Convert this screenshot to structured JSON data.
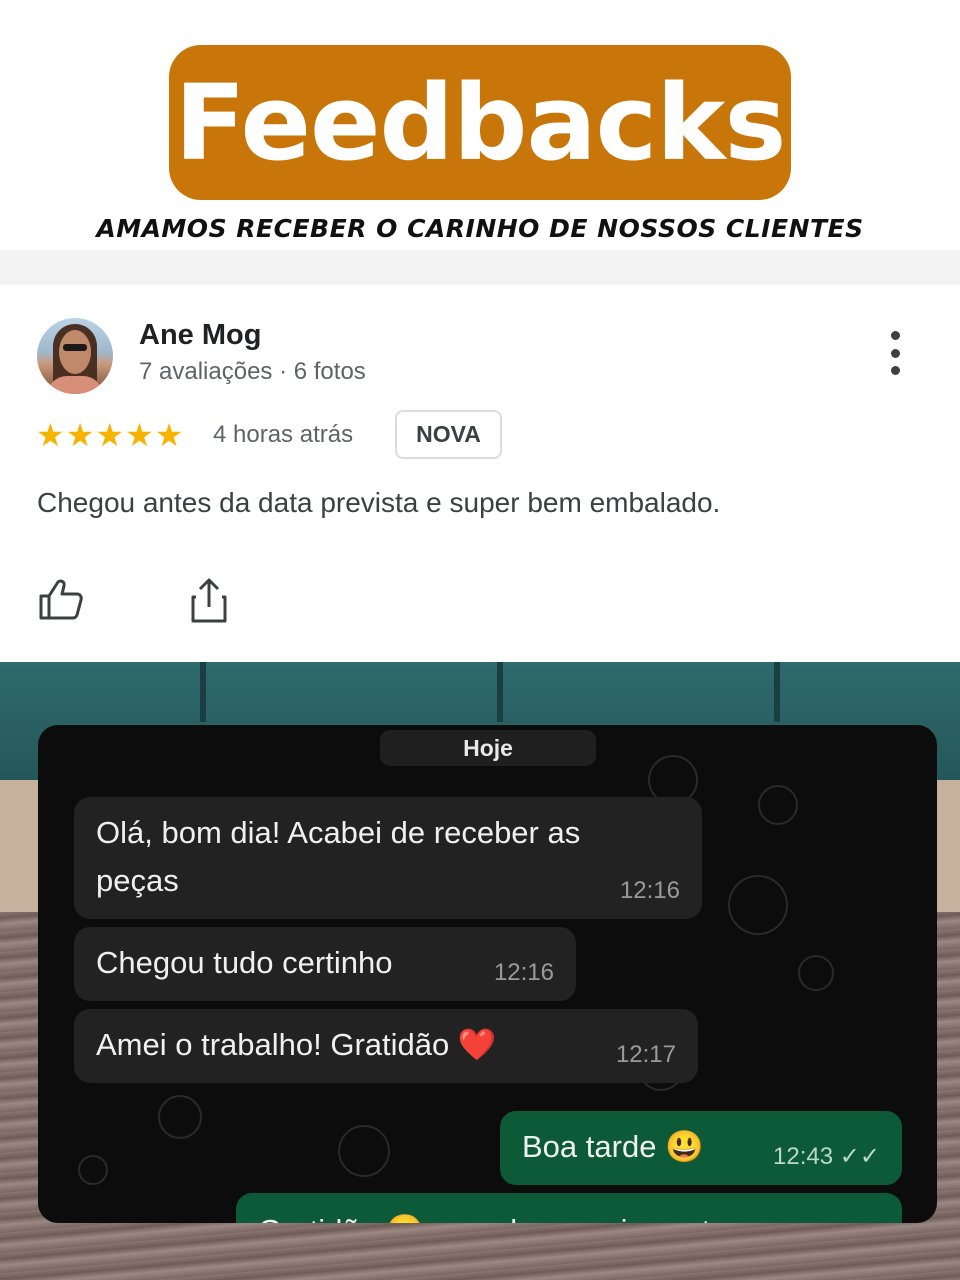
{
  "header": {
    "title": "Feedbacks",
    "subtitle": "AMAMOS RECEBER O CARINHO DE NOSSOS CLIENTES",
    "accent_color": "#c8760a"
  },
  "review": {
    "name": "Ane Mog",
    "meta": "7 avaliações · 6 fotos",
    "rating": 5,
    "stars": "★★★★★",
    "time_ago": "4 horas atrás",
    "badge": "NOVA",
    "text": "Chegou antes da data prevista e super bem embalado.",
    "star_color": "#f6b400",
    "icons": [
      "kebab-menu-icon",
      "thumbs-up-icon",
      "share-icon"
    ]
  },
  "chat": {
    "date_label": "Hoje",
    "messages": [
      {
        "direction": "in",
        "text_line1": "Olá, bom dia! Acabei de receber as",
        "text_line2": "peças",
        "time": "12:16"
      },
      {
        "direction": "in",
        "text": "Chegou tudo certinho",
        "time": "12:16"
      },
      {
        "direction": "in",
        "text": "Amei o trabalho! Gratidão",
        "emoji": "❤️",
        "time": "12:17"
      },
      {
        "direction": "out",
        "text": "Boa tarde",
        "emoji": "😃",
        "time": "12:43",
        "status": "read",
        "ticks": "✓✓"
      },
      {
        "direction": "out",
        "text": "Gratidão 😊 e qualquer coisa estou a",
        "partial": true
      }
    ],
    "incoming_color": "#222222",
    "outgoing_color": "#0c5a37"
  }
}
